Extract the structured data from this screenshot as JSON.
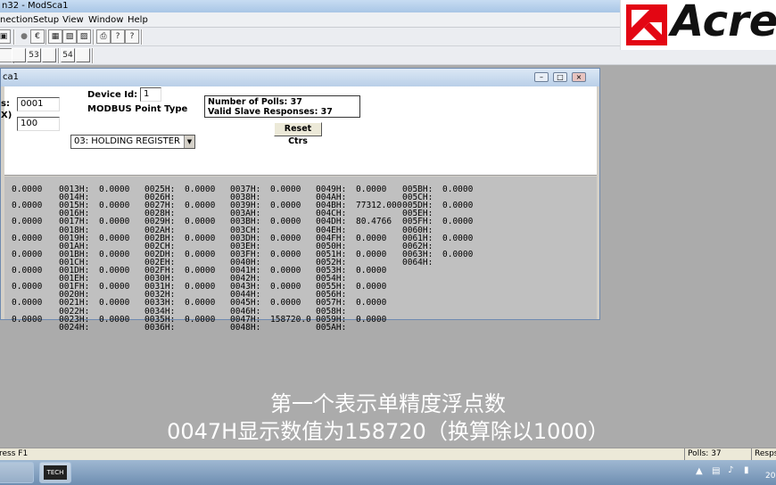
{
  "app": {
    "title": "n32 - ModSca1"
  },
  "menu": [
    "nection",
    "Setup",
    "View",
    "Window",
    "Help"
  ],
  "toolbar2_labels": [
    "",
    "",
    "53",
    "",
    "54",
    ""
  ],
  "logo": {
    "text": "Acre",
    "brand_color": "#e30613"
  },
  "child": {
    "title": "ca1"
  },
  "config": {
    "address_label": "s:",
    "address_value": "0001",
    "length_label": "X)",
    "length_value": "100",
    "device_id_label": "Device Id:",
    "device_id_value": "1",
    "point_type_label": "MODBUS Point Type",
    "point_type_value": "03: HOLDING REGISTER",
    "polls_line": "Number of Polls: 37",
    "responses_line": "Valid Slave Responses: 37",
    "reset_label": "Reset Ctrs"
  },
  "registers": {
    "columns": [
      {
        "rows": [
          {
            "addr": "",
            "val": "0.0000"
          },
          {
            "addr": "",
            "val": ""
          },
          {
            "addr": "",
            "val": "0.0000"
          },
          {
            "addr": "",
            "val": ""
          },
          {
            "addr": "",
            "val": "0.0000"
          },
          {
            "addr": "",
            "val": ""
          },
          {
            "addr": "",
            "val": "0.0000"
          },
          {
            "addr": "",
            "val": ""
          },
          {
            "addr": "",
            "val": "0.0000"
          },
          {
            "addr": "",
            "val": ""
          },
          {
            "addr": "",
            "val": "0.0000"
          },
          {
            "addr": "",
            "val": ""
          },
          {
            "addr": "",
            "val": "0.0000"
          },
          {
            "addr": "",
            "val": ""
          },
          {
            "addr": "",
            "val": "0.0000"
          },
          {
            "addr": "",
            "val": ""
          },
          {
            "addr": "",
            "val": "0.0000"
          },
          {
            "addr": "",
            "val": ""
          }
        ]
      },
      {
        "rows": [
          {
            "addr": "0013H:",
            "val": "0.0000"
          },
          {
            "addr": "0014H:",
            "val": ""
          },
          {
            "addr": "0015H:",
            "val": "0.0000"
          },
          {
            "addr": "0016H:",
            "val": ""
          },
          {
            "addr": "0017H:",
            "val": "0.0000"
          },
          {
            "addr": "0018H:",
            "val": ""
          },
          {
            "addr": "0019H:",
            "val": "0.0000"
          },
          {
            "addr": "001AH:",
            "val": ""
          },
          {
            "addr": "001BH:",
            "val": "0.0000"
          },
          {
            "addr": "001CH:",
            "val": ""
          },
          {
            "addr": "001DH:",
            "val": "0.0000"
          },
          {
            "addr": "001EH:",
            "val": ""
          },
          {
            "addr": "001FH:",
            "val": "0.0000"
          },
          {
            "addr": "0020H:",
            "val": ""
          },
          {
            "addr": "0021H:",
            "val": "0.0000"
          },
          {
            "addr": "0022H:",
            "val": ""
          },
          {
            "addr": "0023H:",
            "val": "0.0000"
          },
          {
            "addr": "0024H:",
            "val": ""
          }
        ]
      },
      {
        "rows": [
          {
            "addr": "0025H:",
            "val": "0.0000"
          },
          {
            "addr": "0026H:",
            "val": ""
          },
          {
            "addr": "0027H:",
            "val": "0.0000"
          },
          {
            "addr": "0028H:",
            "val": ""
          },
          {
            "addr": "0029H:",
            "val": "0.0000"
          },
          {
            "addr": "002AH:",
            "val": ""
          },
          {
            "addr": "002BH:",
            "val": "0.0000"
          },
          {
            "addr": "002CH:",
            "val": ""
          },
          {
            "addr": "002DH:",
            "val": "0.0000"
          },
          {
            "addr": "002EH:",
            "val": ""
          },
          {
            "addr": "002FH:",
            "val": "0.0000"
          },
          {
            "addr": "0030H:",
            "val": ""
          },
          {
            "addr": "0031H:",
            "val": "0.0000"
          },
          {
            "addr": "0032H:",
            "val": ""
          },
          {
            "addr": "0033H:",
            "val": "0.0000"
          },
          {
            "addr": "0034H:",
            "val": ""
          },
          {
            "addr": "0035H:",
            "val": "0.0000"
          },
          {
            "addr": "0036H:",
            "val": ""
          }
        ]
      },
      {
        "rows": [
          {
            "addr": "0037H:",
            "val": "0.0000"
          },
          {
            "addr": "0038H:",
            "val": ""
          },
          {
            "addr": "0039H:",
            "val": "0.0000"
          },
          {
            "addr": "003AH:",
            "val": ""
          },
          {
            "addr": "003BH:",
            "val": "0.0000"
          },
          {
            "addr": "003CH:",
            "val": ""
          },
          {
            "addr": "003DH:",
            "val": "0.0000"
          },
          {
            "addr": "003EH:",
            "val": ""
          },
          {
            "addr": "003FH:",
            "val": "0.0000"
          },
          {
            "addr": "0040H:",
            "val": ""
          },
          {
            "addr": "0041H:",
            "val": "0.0000"
          },
          {
            "addr": "0042H:",
            "val": ""
          },
          {
            "addr": "0043H:",
            "val": "0.0000"
          },
          {
            "addr": "0044H:",
            "val": ""
          },
          {
            "addr": "0045H:",
            "val": "0.0000"
          },
          {
            "addr": "0046H:",
            "val": ""
          },
          {
            "addr": "0047H:",
            "val": "158720.0"
          },
          {
            "addr": "0048H:",
            "val": ""
          }
        ]
      },
      {
        "rows": [
          {
            "addr": "0049H:",
            "val": "0.0000"
          },
          {
            "addr": "004AH:",
            "val": ""
          },
          {
            "addr": "004BH:",
            "val": "77312.000"
          },
          {
            "addr": "004CH:",
            "val": ""
          },
          {
            "addr": "004DH:",
            "val": "80.4766"
          },
          {
            "addr": "004EH:",
            "val": ""
          },
          {
            "addr": "004FH:",
            "val": "0.0000"
          },
          {
            "addr": "0050H:",
            "val": ""
          },
          {
            "addr": "0051H:",
            "val": "0.0000"
          },
          {
            "addr": "0052H:",
            "val": ""
          },
          {
            "addr": "0053H:",
            "val": "0.0000"
          },
          {
            "addr": "0054H:",
            "val": ""
          },
          {
            "addr": "0055H:",
            "val": "0.0000"
          },
          {
            "addr": "0056H:",
            "val": ""
          },
          {
            "addr": "0057H:",
            "val": "0.0000"
          },
          {
            "addr": "0058H:",
            "val": ""
          },
          {
            "addr": "0059H:",
            "val": "0.0000"
          },
          {
            "addr": "005AH:",
            "val": ""
          }
        ]
      },
      {
        "rows": [
          {
            "addr": "005BH:",
            "val": "0.0000"
          },
          {
            "addr": "005CH:",
            "val": ""
          },
          {
            "addr": "005DH:",
            "val": "0.0000"
          },
          {
            "addr": "005EH:",
            "val": ""
          },
          {
            "addr": "005FH:",
            "val": "0.0000"
          },
          {
            "addr": "0060H:",
            "val": ""
          },
          {
            "addr": "0061H:",
            "val": "0.0000"
          },
          {
            "addr": "0062H:",
            "val": ""
          },
          {
            "addr": "0063H:",
            "val": "0.0000"
          },
          {
            "addr": "0064H:",
            "val": ""
          }
        ]
      }
    ]
  },
  "subtitle": {
    "line1": "第一个表示单精度浮点数",
    "line2": "0047H显示数值为158720（换算除以1000）"
  },
  "statusbar": {
    "help": "ress F1",
    "polls": "Polls: 37",
    "resps": "Resps"
  },
  "taskbar": {
    "task2_label": "TECH"
  },
  "tray": {
    "clock": "20"
  }
}
